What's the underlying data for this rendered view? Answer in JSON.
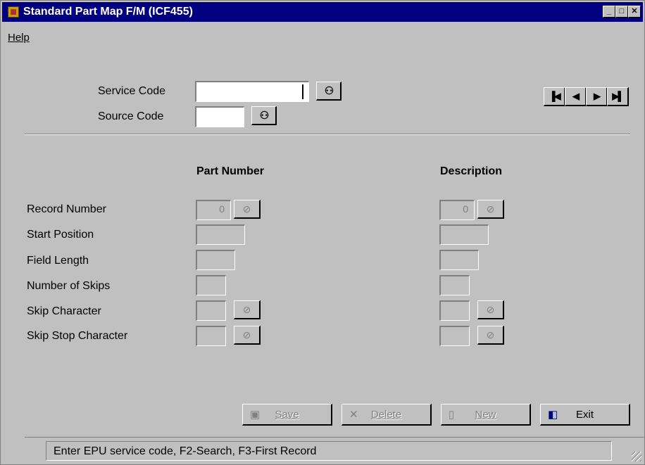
{
  "window": {
    "title": "Standard Part Map F/M (ICF455)",
    "controls": {
      "minimize": "_",
      "maximize": "□",
      "close": "✕"
    }
  },
  "menu": {
    "help": "Help"
  },
  "form": {
    "service_code_label": "Service Code",
    "service_code_value": "",
    "source_code_label": "Source Code",
    "source_code_value": ""
  },
  "record_nav": {
    "first": "first-record-icon",
    "prev": "previous-record-icon",
    "next": "next-record-icon",
    "last": "last-record-icon"
  },
  "columns": {
    "part_number": "Part Number",
    "description": "Description"
  },
  "rows": {
    "record_number": "Record Number",
    "start_position": "Start Position",
    "field_length": "Field Length",
    "number_of_skips": "Number of Skips",
    "skip_character": "Skip Character",
    "skip_stop_character": "Skip Stop Character"
  },
  "values": {
    "part_record_number": "0",
    "desc_record_number": "0"
  },
  "buttons": {
    "save": "Save",
    "delete": "Delete",
    "new": "New",
    "exit": "Exit"
  },
  "status": {
    "message": "Enter EPU service code, F2-Search, F3-First Record"
  }
}
